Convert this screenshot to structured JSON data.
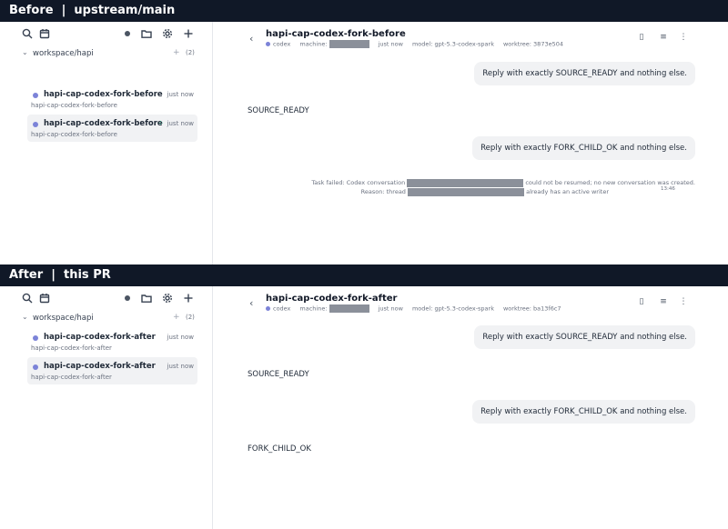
{
  "before": {
    "banner": "Before  |  upstream/main",
    "sidebar": {
      "group_name": "workspace/hapi",
      "group_count": "(2)",
      "sessions": [
        {
          "title": "hapi-cap-codex-fork-before",
          "subtitle": "hapi-cap-codex-fork-before",
          "time": "just now"
        },
        {
          "title": "hapi-cap-codex-fork-before",
          "subtitle": "hapi-cap-codex-fork-before",
          "time": "just now"
        }
      ]
    },
    "header": {
      "title": "hapi-cap-codex-fork-before",
      "agent": "codex",
      "machine_label": "machine:",
      "time": "just now",
      "model": "model: gpt-5.3-codex-spark",
      "worktree": "worktree: 3873e504"
    },
    "messages": {
      "user1": "Reply with exactly SOURCE_READY and nothing else.",
      "reply1": "SOURCE_READY",
      "user2": "Reply with exactly FORK_CHILD_OK and nothing else.",
      "error_line1_a": "Task failed: Codex conversation",
      "error_line1_b": "could not be resumed; no new conversation was created.",
      "error_line2_a": "Reason: thread",
      "error_line2_b": "already has an active writer",
      "error_time": "13:46"
    }
  },
  "after": {
    "banner": "After  |  this PR",
    "sidebar": {
      "group_name": "workspace/hapi",
      "group_count": "(2)",
      "sessions": [
        {
          "title": "hapi-cap-codex-fork-after",
          "subtitle": "hapi-cap-codex-fork-after",
          "time": "just now"
        },
        {
          "title": "hapi-cap-codex-fork-after",
          "subtitle": "hapi-cap-codex-fork-after",
          "time": "just now"
        }
      ]
    },
    "header": {
      "title": "hapi-cap-codex-fork-after",
      "agent": "codex",
      "machine_label": "machine:",
      "time": "just now",
      "model": "model: gpt-5.3-codex-spark",
      "worktree": "worktree: ba13f6c7"
    },
    "messages": {
      "user1": "Reply with exactly SOURCE_READY and nothing else.",
      "reply1": "SOURCE_READY",
      "user2": "Reply with exactly FORK_CHILD_OK and nothing else.",
      "reply2": "FORK_CHILD_OK"
    }
  },
  "icons": {
    "search": "search-icon",
    "calendar": "calendar-icon",
    "status": "status-dot-icon",
    "folder": "folder-icon",
    "settings": "gear-icon",
    "new": "plus-icon",
    "back": "chevron-left-icon",
    "file": "file-icon",
    "list": "list-icon",
    "more": "more-vertical-icon"
  },
  "colors": {
    "banner_bg": "#101827",
    "agent_dot": "#7c83d8",
    "spinner": "#10b981",
    "bubble_bg": "#f1f2f4",
    "redaction": "#8b909a"
  }
}
